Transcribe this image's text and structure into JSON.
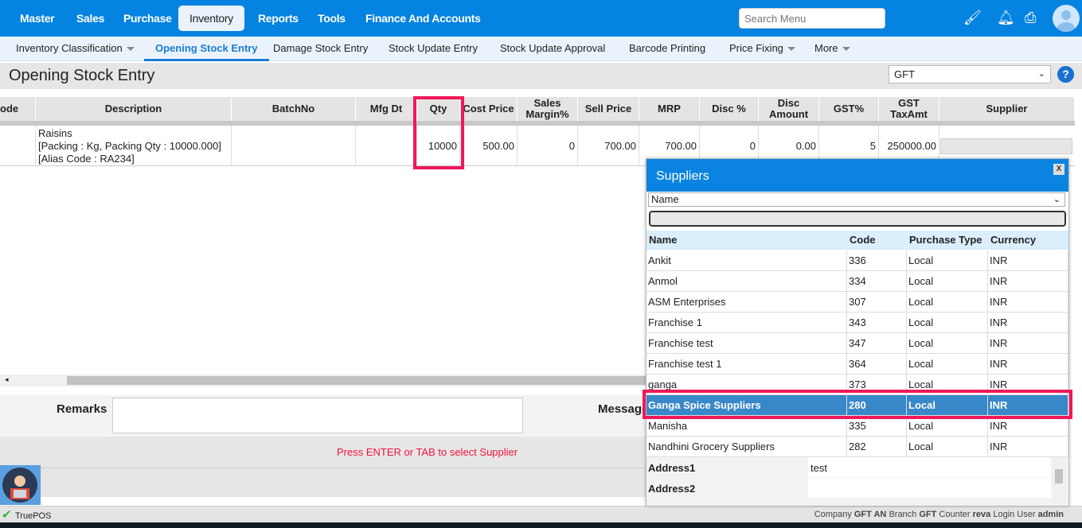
{
  "topnav": {
    "items": [
      "Master",
      "Sales",
      "Purchase",
      "Inventory",
      "Reports",
      "Tools",
      "Finance And Accounts"
    ],
    "active": "Inventory",
    "search_placeholder": "Search Menu"
  },
  "subnav": {
    "items": [
      "Inventory Classification",
      "Opening Stock Entry",
      "Damage Stock Entry",
      "Stock Update Entry",
      "Stock Update Approval",
      "Barcode Printing",
      "Price Fixing",
      "More"
    ]
  },
  "page": {
    "title": "Opening Stock Entry",
    "company_select": "GFT",
    "help": "?"
  },
  "grid": {
    "headers": [
      "ode",
      "Description",
      "BatchNo",
      "Mfg Dt",
      "Qty",
      "Cost Price",
      "Sales Margin%",
      "Sell Price",
      "MRP",
      "Disc %",
      "Disc Amount",
      "GST%",
      "GST TaxAmt",
      "Supplier"
    ],
    "row": {
      "desc1": "Raisins",
      "desc2": "[Packing : Kg, Packing Qty : 10000.000]",
      "desc3": "[Alias Code : RA234]",
      "qty": "10000",
      "cost": "500.00",
      "margin": "0",
      "sell": "700.00",
      "mrp": "700.00",
      "disc": "0",
      "disc_amt": "0.00",
      "gst": "5",
      "gst_amt": "250000.00"
    }
  },
  "bottom": {
    "remarks_label": "Remarks",
    "message_label": "Message",
    "hint": "Press ENTER or TAB to select Supplier"
  },
  "popup": {
    "title": "Suppliers",
    "close": "X",
    "filter_select": "Name",
    "headers": [
      "Name",
      "Code",
      "Purchase Type",
      "Currency"
    ],
    "rows": [
      [
        "Ankit",
        "336",
        "Local",
        "INR"
      ],
      [
        "Anmol",
        "334",
        "Local",
        "INR"
      ],
      [
        "ASM Enterprises",
        "307",
        "Local",
        "INR"
      ],
      [
        "Franchise 1",
        "343",
        "Local",
        "INR"
      ],
      [
        "Franchise test",
        "347",
        "Local",
        "INR"
      ],
      [
        "Franchise test 1",
        "364",
        "Local",
        "INR"
      ],
      [
        "ganga",
        "373",
        "Local",
        "INR"
      ],
      [
        "Ganga Spice Suppliers",
        "280",
        "Local",
        "INR"
      ],
      [
        "Manisha",
        "335",
        "Local",
        "INR"
      ],
      [
        "Nandhini Grocery Suppliers",
        "282",
        "Local",
        "INR"
      ]
    ],
    "selected_index": 7,
    "address1_label": "Address1",
    "address1": "test",
    "address2_label": "Address2"
  },
  "status": {
    "app": "TruePOS",
    "company_label": "Company",
    "company": "GFT AN",
    "branch_label": "Branch",
    "branch": "GFT",
    "counter_label": "Counter",
    "counter": "reva",
    "user_label": "Login User",
    "user": "admin"
  }
}
